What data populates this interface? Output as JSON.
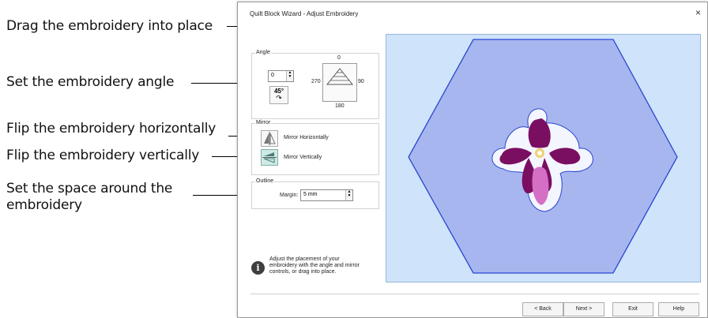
{
  "callouts": {
    "drag": "Drag the embroidery into place",
    "angle": "Set the embroidery angle",
    "flip_h": "Flip the embroidery horizontally",
    "flip_v": "Flip the embroidery vertically",
    "space_line1": "Set the space around the",
    "space_line2": "embroidery"
  },
  "dialog": {
    "title": "Quilt Block Wizard - Adjust Embroidery",
    "close_glyph": "×",
    "angle": {
      "group_label": "Angle",
      "value": "0",
      "rotate_label": "45°",
      "dial_top": "0",
      "dial_left": "270",
      "dial_right": "90",
      "dial_bottom": "180"
    },
    "mirror": {
      "group_label": "Mirror",
      "horizontal_label": "Mirror Horizontally",
      "vertical_label": "Mirror Vertically"
    },
    "outline": {
      "group_label": "Outline",
      "margin_label": "Margin:",
      "margin_value": "5 mm"
    },
    "info_text": "Adjust the placement of your embroidery with the angle and mirror controls, or drag into place.",
    "buttons": {
      "back": "< Back",
      "next": "Next >",
      "exit": "Exit",
      "help": "Help"
    }
  },
  "colors": {
    "preview_bg": "#cfe4fb",
    "hexagon_fill": "#a7b6ee",
    "hexagon_stroke": "#2b46d0",
    "flower_dark": "#7a0f62",
    "flower_light": "#d46fc5",
    "outline_white": "#f4f6ff"
  }
}
